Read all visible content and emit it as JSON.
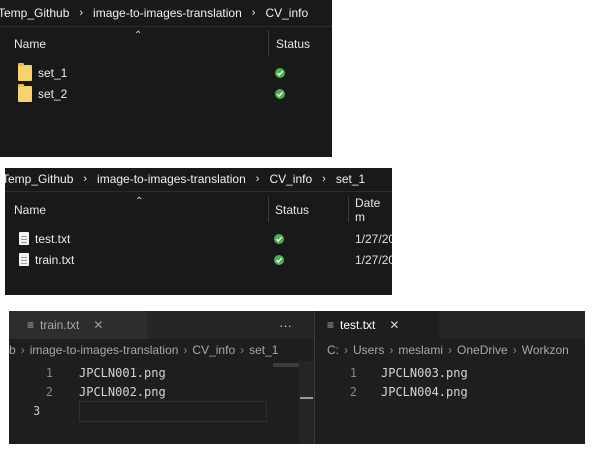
{
  "explorer1": {
    "breadcrumb": [
      "Temp_Github",
      "image-to-images-translation",
      "CV_info"
    ],
    "columns": {
      "name": "Name",
      "status": "Status"
    },
    "rows": [
      {
        "name": "set_1",
        "type": "folder",
        "icon": "folder-icon",
        "status": "synced"
      },
      {
        "name": "set_2",
        "type": "folder",
        "icon": "folder-icon",
        "status": "synced"
      }
    ]
  },
  "explorer2": {
    "breadcrumb": [
      "Temp_Github",
      "image-to-images-translation",
      "CV_info",
      "set_1"
    ],
    "columns": {
      "name": "Name",
      "status": "Status",
      "date": "Date m"
    },
    "rows": [
      {
        "name": "test.txt",
        "type": "file",
        "icon": "file-icon",
        "status": "synced",
        "date": "1/27/20"
      },
      {
        "name": "train.txt",
        "type": "file",
        "icon": "file-icon",
        "status": "synced",
        "date": "1/27/20"
      }
    ]
  },
  "vscode": {
    "left": {
      "tab": "train.txt",
      "more": "···",
      "breadcrumb": [
        "b",
        "image-to-images-translation",
        "CV_info",
        "set_1"
      ],
      "lines": [
        {
          "n": "1",
          "text": "JPCLN001.png"
        },
        {
          "n": "2",
          "text": "JPCLN002.png"
        },
        {
          "n": "3",
          "text": ""
        }
      ]
    },
    "right": {
      "tab": "test.txt",
      "breadcrumb": [
        "C:",
        "Users",
        "meslami",
        "OneDrive",
        "Workzon"
      ],
      "lines": [
        {
          "n": "1",
          "text": "JPCLN003.png"
        },
        {
          "n": "2",
          "text": "JPCLN004.png"
        }
      ]
    },
    "colors": {
      "background": "#1e1e1e",
      "tabbar": "#252526",
      "accent": "#d4d4d4"
    }
  },
  "status_colors": {
    "synced": "#4caf50"
  }
}
